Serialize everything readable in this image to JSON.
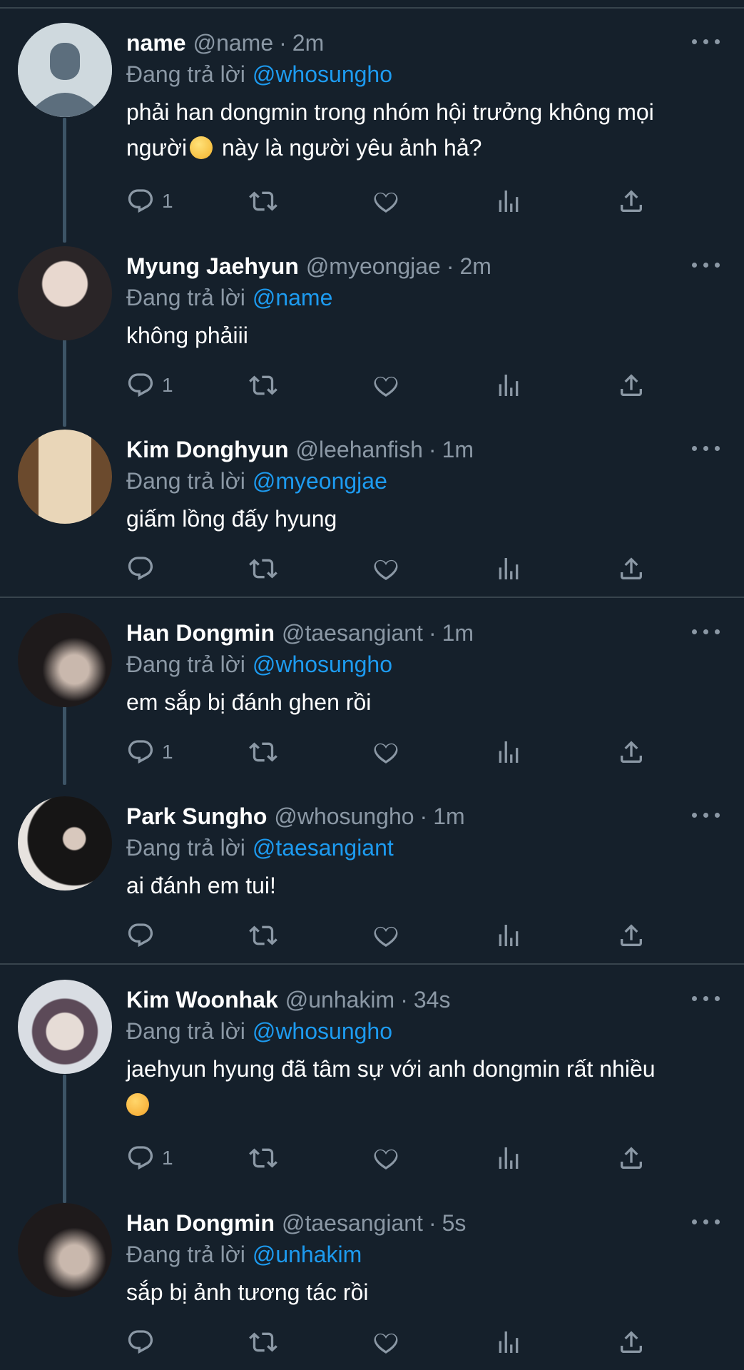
{
  "reply_prefix": "Đang trả lời",
  "dot": "·",
  "colors": {
    "background": "#15202b",
    "text": "#ffffff",
    "secondary": "#8b98a5",
    "link": "#1d9bf0",
    "divider": "#38444d"
  },
  "tweets": [
    {
      "name": "name",
      "handle": "@name",
      "time": "2m",
      "reply_to": "@whosungho",
      "text_a": "phải han dongmin trong nhóm hội trưởng không mọi người",
      "emoji": "face-with-monocle",
      "text_b": " này là người yêu ảnh hả?",
      "replies": "1",
      "avatar": "default-avatar"
    },
    {
      "name": "Myung Jaehyun",
      "handle": "@myeongjae",
      "time": "2m",
      "reply_to": "@name",
      "text": "không phảiii",
      "replies": "1",
      "avatar": "photo-avatar"
    },
    {
      "name": "Kim Donghyun",
      "handle": "@leehanfish",
      "time": "1m",
      "reply_to": "@myeongjae",
      "text": "giấm lồng đấy hyung",
      "replies": "",
      "avatar": "photo-avatar"
    },
    {
      "name": "Han Dongmin",
      "handle": "@taesangiant",
      "time": "1m",
      "reply_to": "@whosungho",
      "text": "em sắp bị đánh ghen rồi",
      "replies": "1",
      "avatar": "photo-avatar"
    },
    {
      "name": "Park Sungho",
      "handle": "@whosungho",
      "time": "1m",
      "reply_to": "@taesangiant",
      "text": "ai đánh em tui!",
      "replies": "",
      "avatar": "photo-avatar"
    },
    {
      "name": "Kim Woonhak",
      "handle": "@unhakim",
      "time": "34s",
      "reply_to": "@whosungho",
      "text_a": "jaehyun hyung đã tâm sự với anh dongmin rất nhiều",
      "emoji": "smiling-face-with-hearts",
      "text_b": "",
      "replies": "1",
      "avatar": "photo-avatar"
    },
    {
      "name": "Han Dongmin",
      "handle": "@taesangiant",
      "time": "5s",
      "reply_to": "@unhakim",
      "text": "sắp bị ảnh tương tác rồi",
      "replies": "",
      "avatar": "photo-avatar"
    }
  ]
}
